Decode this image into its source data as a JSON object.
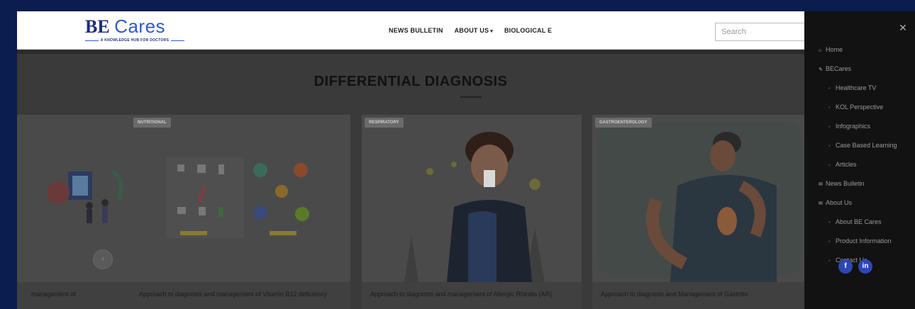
{
  "header": {
    "logo_be": "BE",
    "logo_cares": "Cares",
    "logo_tagline": "A KNOWLEDGE HUB FOR DOCTORS",
    "nav": [
      {
        "label": "NEWS BULLETIN",
        "caret": ""
      },
      {
        "label": "ABOUT US",
        "caret": "▾"
      },
      {
        "label": "BIOLOGICAL E",
        "caret": ""
      }
    ],
    "search_placeholder": "Search"
  },
  "section": {
    "title": "DIFFERENTIAL DIAGNOSIS",
    "cards": [
      {
        "tag": "",
        "caption": "management of"
      },
      {
        "tag": "NUTRITIONAL",
        "caption": "Approach to diagnosis and management of Vitamin B12 deficiency"
      },
      {
        "tag": "RESPIRATORY",
        "caption": "Approach to diagnosis and management of Allergic Rhinitis (AR)"
      },
      {
        "tag": "GASTROENTEROLOGY",
        "caption": "Approach to diagnosis and Management of Gastritis"
      }
    ],
    "prev_arrow": "‹"
  },
  "drawer": {
    "close": "✕",
    "menu": [
      {
        "label": "Home",
        "icon": "home-icon",
        "glyph": "⌂",
        "level": 0
      },
      {
        "label": "BECares",
        "icon": "wrench-icon",
        "glyph": "✎",
        "level": 0
      },
      {
        "label": "Healthcare TV",
        "level": 1
      },
      {
        "label": "KOL Perspective",
        "level": 1
      },
      {
        "label": "Infographics",
        "level": 1
      },
      {
        "label": "Case Based Learning",
        "level": 1
      },
      {
        "label": "Articles",
        "level": 1
      },
      {
        "label": "News Bulletin",
        "icon": "envelope-icon",
        "glyph": "✉",
        "level": 0
      },
      {
        "label": "About Us",
        "icon": "envelope-icon",
        "glyph": "✉",
        "level": 0
      },
      {
        "label": "About BE Cares",
        "level": 1
      },
      {
        "label": "Product Information",
        "level": 1
      },
      {
        "label": "Contact Us",
        "level": 1
      }
    ],
    "social": [
      {
        "label": "f",
        "icon": "facebook-icon"
      },
      {
        "label": "in",
        "icon": "linkedin-icon"
      }
    ]
  },
  "colors": {
    "outer_bg": "#0b1c4f",
    "brand_navy": "#1c2f78",
    "brand_blue": "#2e5bc7",
    "drawer_bg": "#121212",
    "social_blue": "#2d47b5"
  }
}
